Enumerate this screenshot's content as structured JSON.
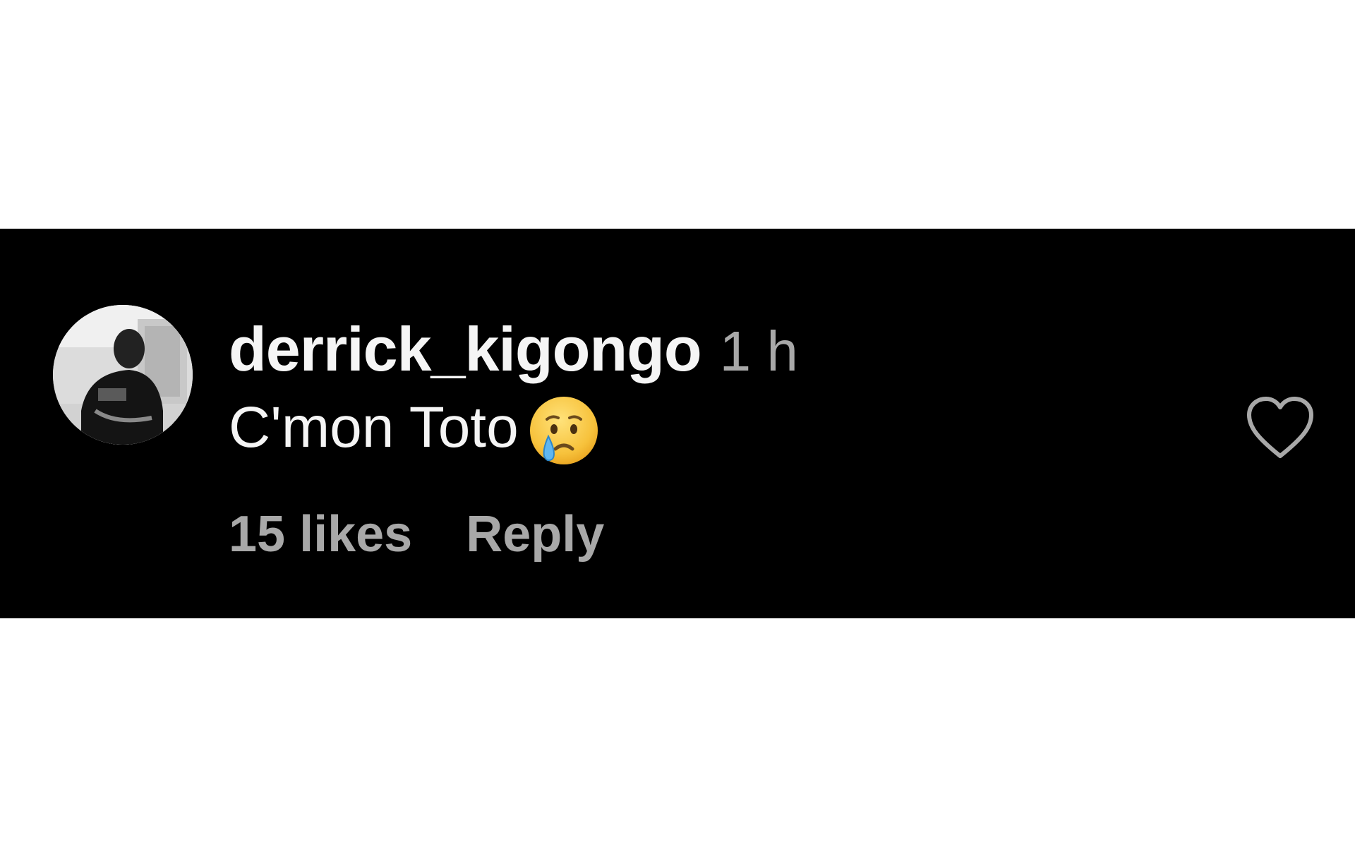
{
  "comment": {
    "username": "derrick_kigongo",
    "timestamp": "1 h",
    "text": "C'mon Toto",
    "emoji": "crying-face",
    "likes_label": "15 likes",
    "reply_label": "Reply"
  },
  "icons": {
    "like": "heart-outline-icon",
    "avatar": "profile-photo"
  },
  "colors": {
    "background": "#000000",
    "primary_text": "#f5f5f5",
    "secondary_text": "#a8a8a8",
    "page": "#ffffff"
  }
}
